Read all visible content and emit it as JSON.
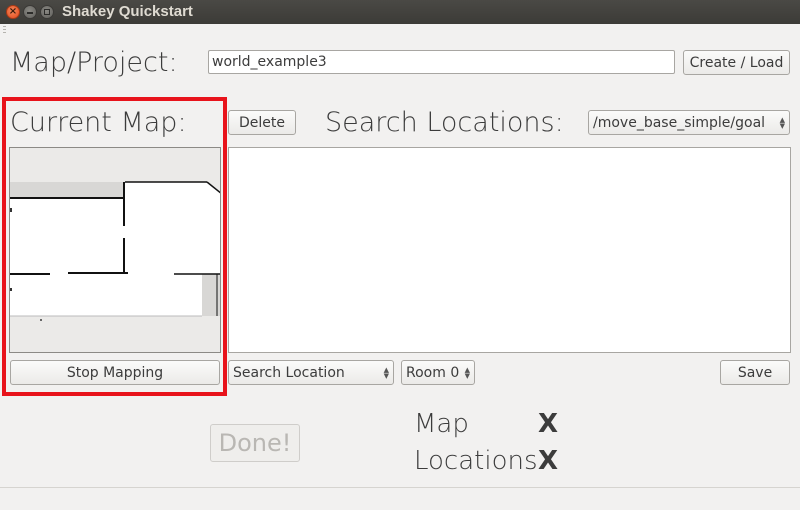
{
  "window": {
    "title": "Shakey Quickstart",
    "close_glyph": "×"
  },
  "project": {
    "label": "Map/Project:",
    "input_value": "world_example3",
    "create_load_label": "Create / Load"
  },
  "current_map": {
    "label": "Current Map:",
    "delete_label": "Delete",
    "stop_mapping_label": "Stop Mapping",
    "map_image_icon": "occupancy-grid-map"
  },
  "search": {
    "label": "Search Locations:",
    "topic_selected": "/move_base_simple/goal",
    "locations": []
  },
  "controls": {
    "search_location_selected": "Search Location",
    "room_selected": "Room 0",
    "save_label": "Save"
  },
  "status": {
    "done_label": "Done!",
    "map_label": "Map",
    "map_state": "X",
    "locations_label": "Locations",
    "locations_state": "X"
  },
  "colors": {
    "highlight": "#e8131b",
    "titlebar": "#3c3b37",
    "background": "#f2f1f0"
  }
}
